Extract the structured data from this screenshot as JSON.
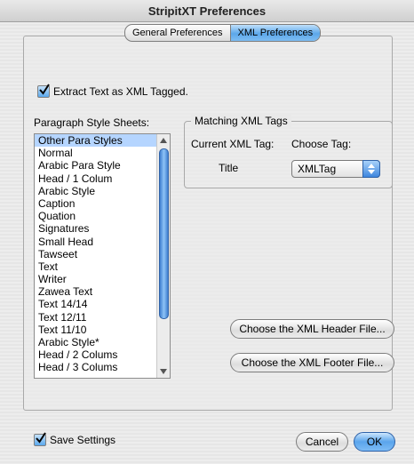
{
  "window": {
    "title": "StripitXT Preferences"
  },
  "tabs": [
    {
      "label": "General Preferences"
    },
    {
      "label": "XML Preferences"
    }
  ],
  "extract": {
    "label": "Extract Text as XML Tagged.",
    "checked": true
  },
  "paragraph": {
    "heading": "Paragraph Style Sheets:",
    "items": [
      "Other Para Styles",
      "Normal",
      "Arabic Para Style",
      "Head / 1 Colum",
      "Arabic Style",
      "Caption",
      "Quation",
      "Signatures",
      "Small Head",
      "Tawseet",
      "Text",
      "Writer",
      "Zawea Text",
      "Text 14/14",
      "Text 12/11",
      "Text 11/10",
      "Arabic Style*",
      "Head / 2 Colums",
      "Head / 3 Colums"
    ]
  },
  "matching": {
    "title": "Matching XML Tags",
    "current_label": "Current XML Tag:",
    "choose_label": "Choose Tag:",
    "current_value": "Title",
    "selected_tag": "XMLTag"
  },
  "buttons": {
    "header": "Choose the XML Header File...",
    "footer": "Choose the XML Footer File...",
    "cancel": "Cancel",
    "ok": "OK"
  },
  "save": {
    "label": "Save Settings",
    "checked": true
  }
}
